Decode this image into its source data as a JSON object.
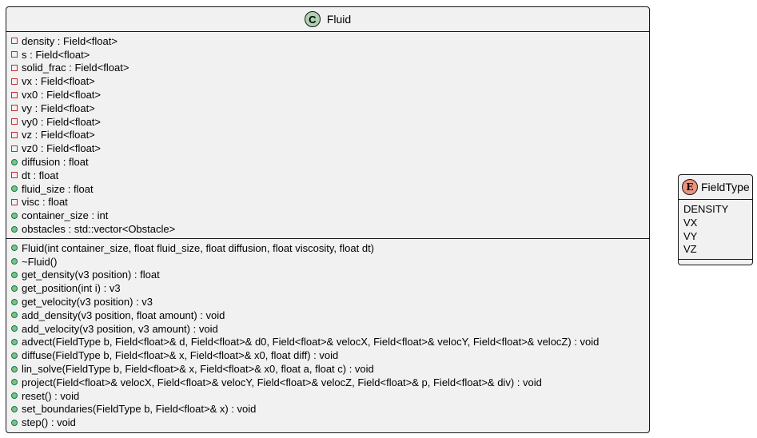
{
  "fluid_class": {
    "stereotype_letter": "C",
    "name": "Fluid",
    "attributes": [
      {
        "visibility": "private",
        "text": "density : Field<float>"
      },
      {
        "visibility": "private",
        "text": "s : Field<float>"
      },
      {
        "visibility": "private",
        "text": "solid_frac : Field<float>"
      },
      {
        "visibility": "private",
        "text": "vx : Field<float>"
      },
      {
        "visibility": "private",
        "text": "vx0 : Field<float>"
      },
      {
        "visibility": "private",
        "text": "vy : Field<float>"
      },
      {
        "visibility": "private",
        "text": "vy0 : Field<float>"
      },
      {
        "visibility": "private",
        "text": "vz : Field<float>"
      },
      {
        "visibility": "private",
        "text": "vz0 : Field<float>"
      },
      {
        "visibility": "public",
        "text": "diffusion : float"
      },
      {
        "visibility": "private",
        "text": "dt : float"
      },
      {
        "visibility": "public",
        "text": "fluid_size : float"
      },
      {
        "visibility": "private",
        "text": "visc : float"
      },
      {
        "visibility": "public",
        "text": "container_size : int"
      },
      {
        "visibility": "public",
        "text": "obstacles : std::vector<Obstacle>"
      }
    ],
    "methods": [
      {
        "visibility": "public",
        "text": "Fluid(int container_size, float fluid_size, float diffusion, float viscosity, float dt)"
      },
      {
        "visibility": "public",
        "text": "~Fluid()"
      },
      {
        "visibility": "public",
        "text": "get_density(v3 position) : float"
      },
      {
        "visibility": "public",
        "text": "get_position(int i) : v3"
      },
      {
        "visibility": "public",
        "text": "get_velocity(v3 position) : v3"
      },
      {
        "visibility": "public",
        "text": "add_density(v3 position, float amount) : void"
      },
      {
        "visibility": "public",
        "text": "add_velocity(v3 position, v3 amount) : void"
      },
      {
        "visibility": "public",
        "text": "advect(FieldType b, Field<float>& d, Field<float>& d0, Field<float>& velocX, Field<float>& velocY, Field<float>& velocZ) : void"
      },
      {
        "visibility": "public",
        "text": "diffuse(FieldType b, Field<float>& x, Field<float>& x0, float diff) : void"
      },
      {
        "visibility": "public",
        "text": "lin_solve(FieldType b, Field<float>& x, Field<float>& x0, float a, float c) : void"
      },
      {
        "visibility": "public",
        "text": "project(Field<float>& velocX, Field<float>& velocY, Field<float>& velocZ, Field<float>& p, Field<float>& div) : void"
      },
      {
        "visibility": "public",
        "text": "reset() : void"
      },
      {
        "visibility": "public",
        "text": "set_boundaries(FieldType b, Field<float>& x) : void"
      },
      {
        "visibility": "public",
        "text": "step() : void"
      }
    ]
  },
  "fieldtype_enum": {
    "stereotype_letter": "E",
    "name": "FieldType",
    "values": [
      "DENSITY",
      "VX",
      "VY",
      "VZ"
    ]
  },
  "colors": {
    "box_fill": "#f1f1f1",
    "border": "#181818",
    "class_circle": "#add1b2",
    "enum_circle": "#eb937f",
    "private_marker": "#c82930",
    "public_marker": "#84be84"
  }
}
